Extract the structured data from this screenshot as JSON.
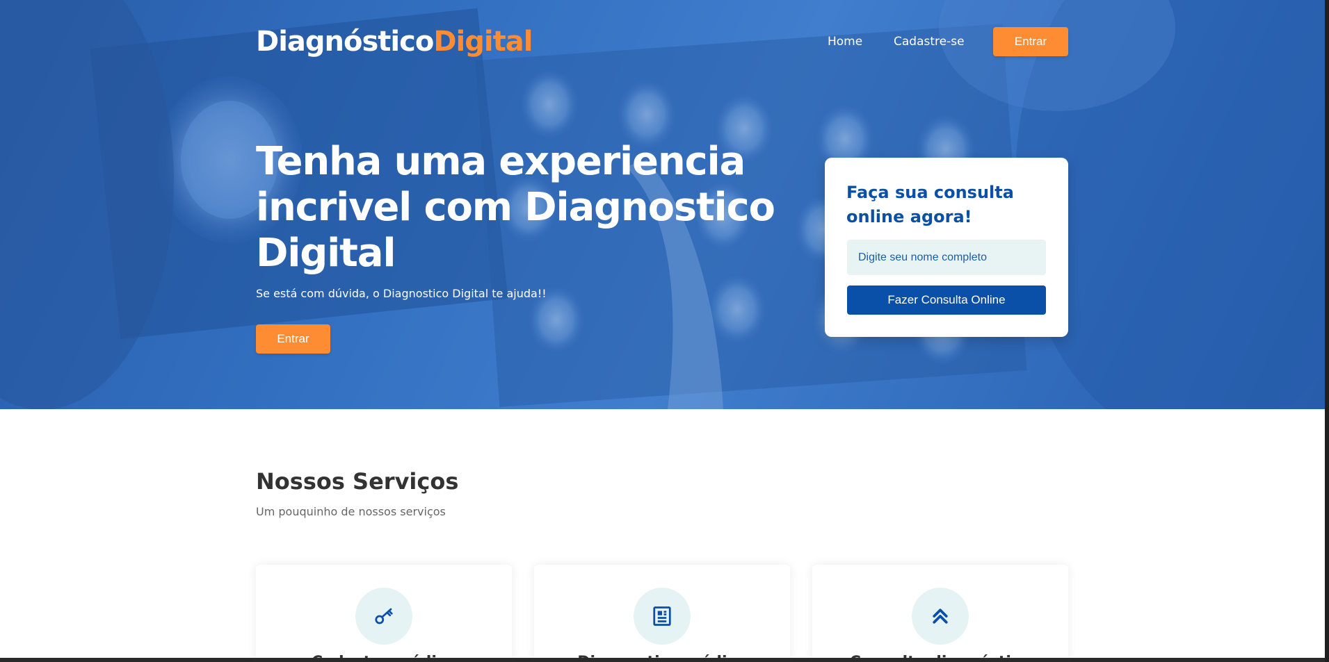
{
  "header": {
    "logo_part1": "Diagnóstico",
    "logo_part2": "Digital",
    "nav": [
      "Home",
      "Cadastre-se"
    ],
    "login_button": "Entrar"
  },
  "hero": {
    "title": "Tenha uma experiencia incrivel com Diagnostico Digital",
    "subtitle": "Se está com dúvida, o Diagnostico Digital te ajuda!!",
    "cta_button": "Entrar"
  },
  "consult_card": {
    "title": "Faça sua consulta online agora!",
    "input_placeholder": "Digite seu nome completo",
    "submit_button": "Fazer Consulta Online"
  },
  "services": {
    "title": "Nossos Serviços",
    "subtitle": "Um pouquinho de nossos serviços",
    "items": [
      {
        "icon": "key-icon",
        "name": "Cadastro médico"
      },
      {
        "icon": "document-icon",
        "name": "Diagnostico médico"
      },
      {
        "icon": "double-chevron-up-icon",
        "name": "Consulta diagnóstico"
      }
    ]
  },
  "colors": {
    "brand_blue": "#0a4fa8",
    "accent_orange": "#fd8c32",
    "icon_circle_bg": "#e6f3f4"
  }
}
